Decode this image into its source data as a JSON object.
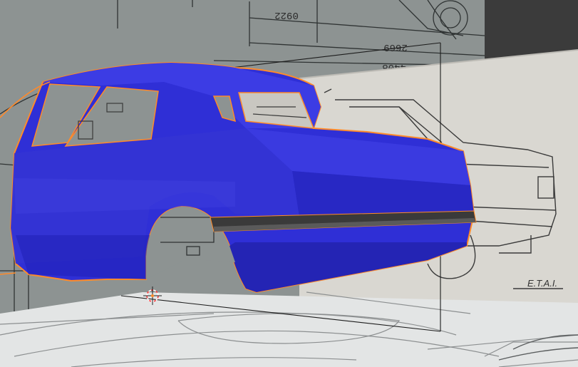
{
  "viewport": {
    "background_dark": "#3a3a3a",
    "blueprint_grey": "#8f9594",
    "blueprint_paper": "#d8d6d0",
    "floor_paper": "#e4e6e6",
    "mesh_color": "#2a2ad8",
    "selection_outline": "#ff8a2a",
    "bumper_color": "#3a3a3a"
  },
  "blueprint_side": {
    "dimension_top": "0922",
    "dimension_mid": "2669",
    "dimension_low": "4408"
  },
  "blueprint_rear": {
    "stamp": "E.T.A.I."
  },
  "scene_objects": {
    "mesh": "car-body-mesh",
    "cursor": "3d-cursor"
  }
}
